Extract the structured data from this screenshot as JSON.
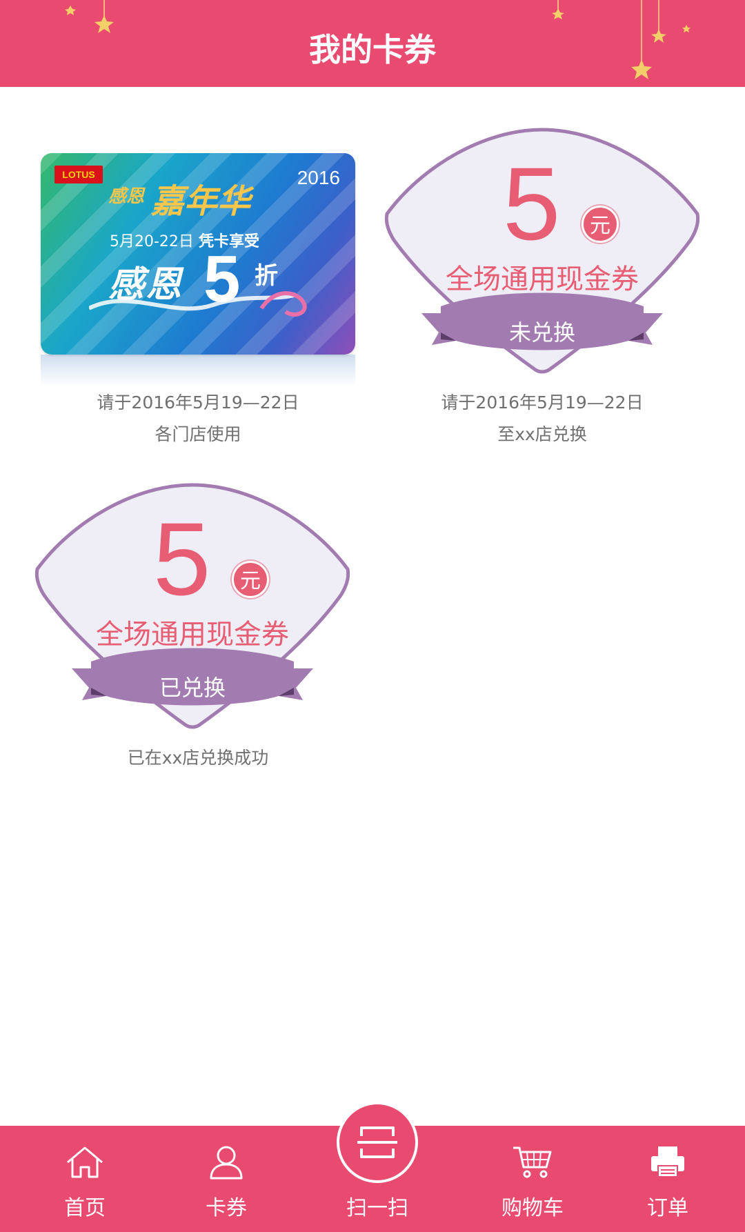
{
  "header": {
    "title": "我的卡券"
  },
  "cards": [
    {
      "type": "gift-card",
      "image": {
        "logo": "LOTUS",
        "year": "2016",
        "title_small": "感恩",
        "title_big": "嘉年华",
        "date_range": "5月20-22日",
        "perk": "凭卡享受",
        "discount_word": "感恩",
        "discount_number": "5",
        "discount_unit": "折"
      },
      "caption_line1": "请于2016年5月19—22日",
      "caption_line2": "各门店使用"
    },
    {
      "type": "coupon",
      "amount": "5",
      "unit": "元",
      "description": "全场通用现金券",
      "status": "未兑换",
      "caption_line1": "请于2016年5月19—22日",
      "caption_line2": "至xx店兑换"
    },
    {
      "type": "coupon",
      "amount": "5",
      "unit": "元",
      "description": "全场通用现金券",
      "status": "已兑换",
      "caption_line1": "已在xx店兑换成功"
    }
  ],
  "bottom_nav": {
    "items": [
      {
        "label": "首页",
        "icon": "home-icon"
      },
      {
        "label": "卡券",
        "icon": "user-icon"
      },
      {
        "label": "扫一扫",
        "icon": "scan-icon"
      },
      {
        "label": "购物车",
        "icon": "cart-icon"
      },
      {
        "label": "订单",
        "icon": "printer-icon"
      }
    ]
  },
  "colors": {
    "brand": "#e94a70",
    "coupon_text": "#e75d73",
    "coupon_outline": "#a27bb1",
    "coupon_fill": "#efeef6",
    "caption_text": "#6f6f6f"
  }
}
